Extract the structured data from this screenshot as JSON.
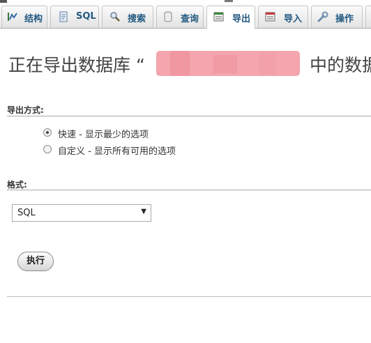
{
  "tabs": [
    {
      "label": "结构",
      "icon": "structure-icon",
      "active": false
    },
    {
      "label": "SQL",
      "icon": "sql-icon",
      "active": false
    },
    {
      "label": "搜索",
      "icon": "search-icon",
      "active": false
    },
    {
      "label": "查询",
      "icon": "query-icon",
      "active": false
    },
    {
      "label": "导出",
      "icon": "export-icon",
      "active": true
    },
    {
      "label": "导入",
      "icon": "import-icon",
      "active": false
    },
    {
      "label": "操作",
      "icon": "wrench-icon",
      "active": false
    }
  ],
  "page": {
    "heading_prefix": "正在导出数据库 “",
    "heading_suffix": "中的数据"
  },
  "export_method": {
    "title": "导出方式:",
    "options": [
      {
        "label": "快速 - 显示最少的选项",
        "selected": true
      },
      {
        "label": "自定义 - 显示所有可用的选项",
        "selected": false
      }
    ]
  },
  "format": {
    "title": "格式:",
    "selected": "SQL"
  },
  "actions": {
    "go_label": "执行"
  }
}
